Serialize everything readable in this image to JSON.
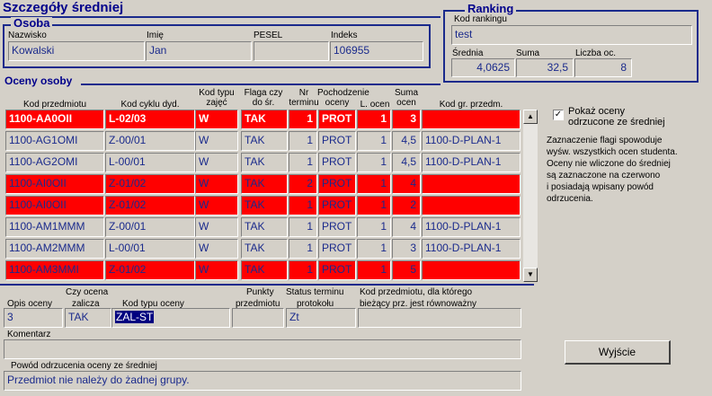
{
  "window_title": "Szczegóły średniej",
  "osoba": {
    "legend": "Osoba",
    "nazwisko_label": "Nazwisko",
    "nazwisko_value": "Kowalski",
    "imie_label": "Imię",
    "imie_value": "Jan",
    "pesel_label": "PESEL",
    "pesel_value": "",
    "indeks_label": "Indeks",
    "indeks_value": "106955"
  },
  "ranking": {
    "legend": "Ranking",
    "kod_label": "Kod rankingu",
    "kod_value": "test",
    "srednia_label": "Średnia",
    "srednia_value": "4,0625",
    "suma_label": "Suma",
    "suma_value": "32,5",
    "liczba_label": "Liczba oc.",
    "liczba_value": "8"
  },
  "oceny": {
    "legend": "Oceny osoby",
    "headers": {
      "kod_przedmiotu": "Kod przedmiotu",
      "kod_cyklu": "Kod cyklu dyd.",
      "kod_typu": "Kod typu zajęć",
      "flaga": "Flaga czy do śr.",
      "nr_terminu": "Nr terminu",
      "pochodzenie": "Pochodzenie oceny",
      "l_ocen": "L. ocen",
      "suma_ocen": "Suma ocen",
      "kod_gr": "Kod gr. przedm."
    },
    "rows": [
      {
        "kod": "1100-AA0OII",
        "cykl": "L-02/03",
        "typ": "W",
        "flaga": "TAK",
        "nr": "1",
        "poch": "PROT",
        "l": "1",
        "suma": "3",
        "gr": "",
        "style": "sel"
      },
      {
        "kod": "1100-AG1OMI",
        "cykl": "Z-00/01",
        "typ": "W",
        "flaga": "TAK",
        "nr": "1",
        "poch": "PROT",
        "l": "1",
        "suma": "4,5",
        "gr": "1100-D-PLAN-1",
        "style": "norm"
      },
      {
        "kod": "1100-AG2OMI",
        "cykl": "L-00/01",
        "typ": "W",
        "flaga": "TAK",
        "nr": "1",
        "poch": "PROT",
        "l": "1",
        "suma": "4,5",
        "gr": "1100-D-PLAN-1",
        "style": "norm"
      },
      {
        "kod": "1100-AI0OII",
        "cykl": "Z-01/02",
        "typ": "W",
        "flaga": "TAK",
        "nr": "2",
        "poch": "PROT",
        "l": "1",
        "suma": "4",
        "gr": "",
        "style": "red"
      },
      {
        "kod": "1100-AI0OII",
        "cykl": "Z-01/02",
        "typ": "W",
        "flaga": "TAK",
        "nr": "1",
        "poch": "PROT",
        "l": "1",
        "suma": "2",
        "gr": "",
        "style": "red"
      },
      {
        "kod": "1100-AM1MMM",
        "cykl": "Z-00/01",
        "typ": "W",
        "flaga": "TAK",
        "nr": "1",
        "poch": "PROT",
        "l": "1",
        "suma": "4",
        "gr": "1100-D-PLAN-1",
        "style": "norm"
      },
      {
        "kod": "1100-AM2MMM",
        "cykl": "L-00/01",
        "typ": "W",
        "flaga": "TAK",
        "nr": "1",
        "poch": "PROT",
        "l": "1",
        "suma": "3",
        "gr": "1100-D-PLAN-1",
        "style": "norm"
      },
      {
        "kod": "1100-AM3MMI",
        "cykl": "Z-01/02",
        "typ": "W",
        "flaga": "TAK",
        "nr": "1",
        "poch": "PROT",
        "l": "1",
        "suma": "5",
        "gr": "",
        "style": "red"
      }
    ]
  },
  "side": {
    "checkbox_label_1": "Pokaż oceny",
    "checkbox_label_2": "odrzucone ze średniej",
    "checkbox_checked": true,
    "info_lines": [
      "Zaznaczenie flagi spowoduje",
      "wyśw. wszystkich ocen studenta.",
      "Oceny nie wliczone do średniej",
      "są zaznaczone na czerwono",
      "i posiadają wpisany powód",
      "odrzucenia."
    ]
  },
  "details": {
    "opis_label": "Opis oceny",
    "opis_value": "3",
    "zalicza_label_1": "Czy ocena",
    "zalicza_label_2": "zalicza",
    "zalicza_value": "TAK",
    "kod_typu_label": "Kod typu oceny",
    "kod_typu_value": "ZAL-ST",
    "punkty_label_1": "Punkty",
    "punkty_label_2": "przedmiotu",
    "punkty_value": "",
    "status_label_1": "Status terminu",
    "status_label_2": "protokołu",
    "status_value": "Zt",
    "kod_przedm_label_1": "Kod przedmiotu, dla którego",
    "kod_przedm_label_2": "bieżący prz. jest równoważny",
    "kod_przedm_value": "",
    "komentarz_label": "Komentarz",
    "komentarz_value": "",
    "powod_label": "Powód odrzucenia oceny ze średniej",
    "powod_value": "Przedmiot nie należy do żadnej grupy."
  },
  "buttons": {
    "wyjscie": "Wyjście"
  },
  "colors": {
    "accent": "#1a2a8c",
    "reject_row": "#ff0000",
    "background": "#d4d0c8"
  }
}
